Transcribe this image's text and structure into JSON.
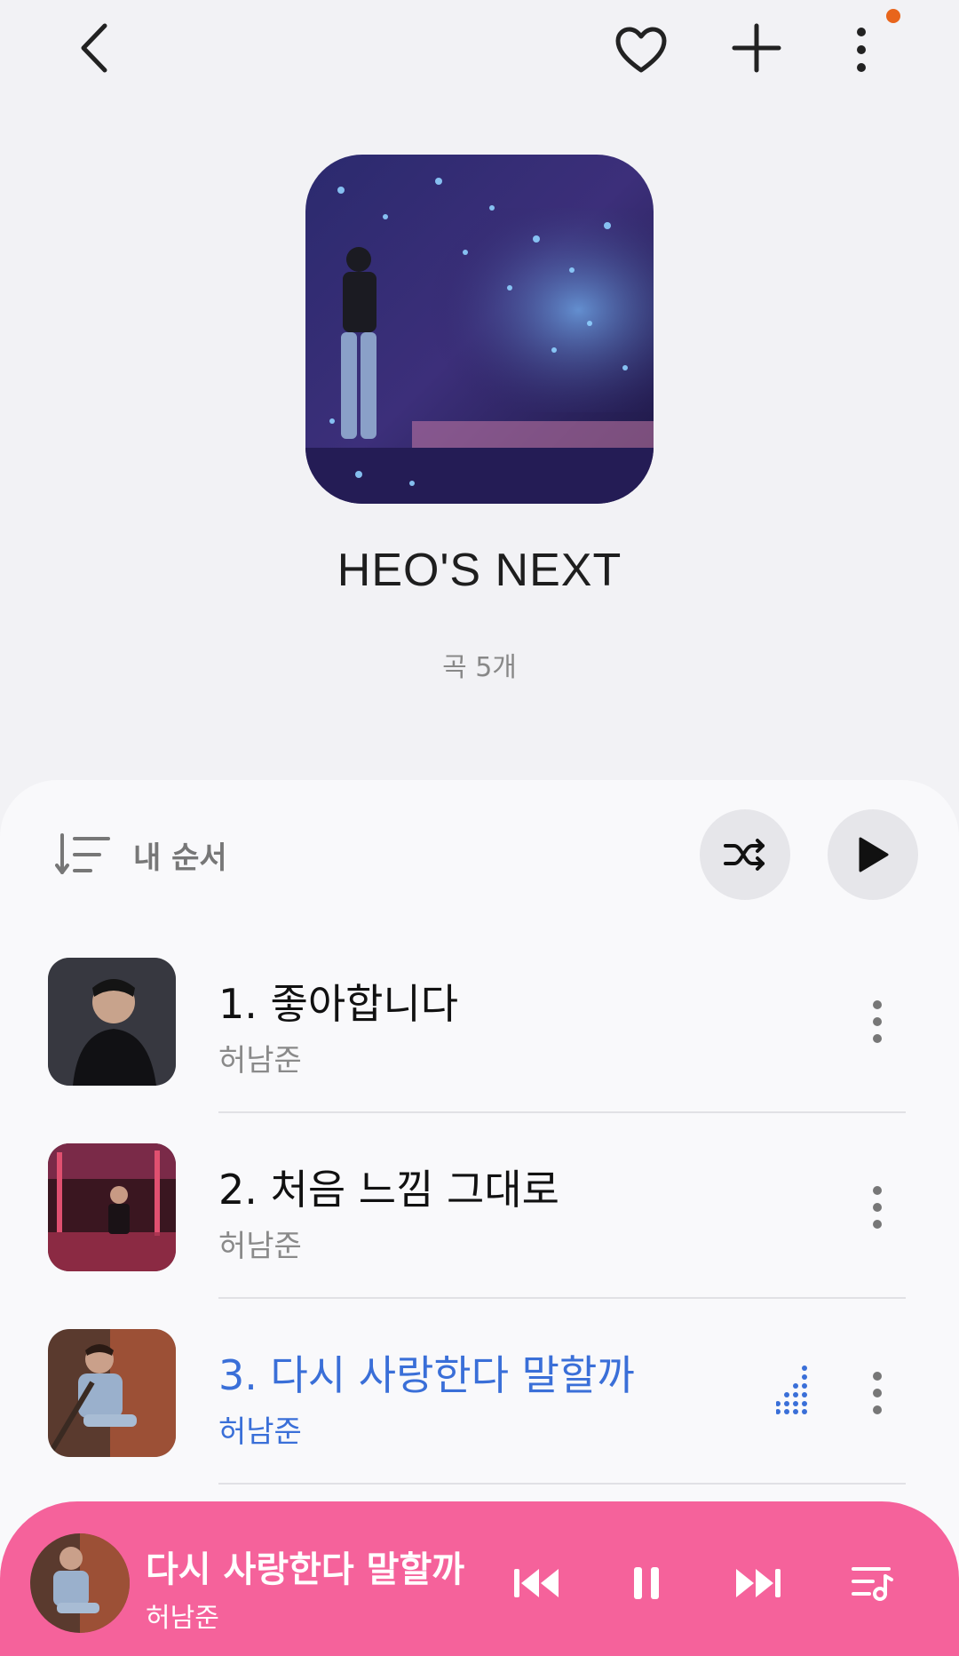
{
  "header": {
    "back_icon": "back-arrow-icon",
    "favorite_icon": "heart-icon",
    "add_icon": "plus-icon",
    "more_icon": "more-vertical-icon",
    "notification_dot_color": "#e8651c"
  },
  "playlist": {
    "title": "HEO'S NEXT",
    "song_count": "곡 5개"
  },
  "list_controls": {
    "sort_label": "내 순서",
    "shuffle_icon": "shuffle-icon",
    "play_icon": "play-icon"
  },
  "tracks": [
    {
      "title": "1. 좋아합니다",
      "artist": "허남준",
      "active": false
    },
    {
      "title": "2. 처음 느낌 그대로",
      "artist": "허남준",
      "active": false
    },
    {
      "title": "3. 다시 사랑한다 말할까",
      "artist": "허남준",
      "active": true
    }
  ],
  "now_playing": {
    "title": "다시 사랑한다 말할까",
    "artist": "허남준",
    "bar_color": "#f5629b",
    "controls": [
      "previous-icon",
      "pause-icon",
      "next-icon",
      "queue-icon"
    ]
  },
  "colors": {
    "active_track": "#3a6fd8",
    "background": "#f2f2f5"
  }
}
